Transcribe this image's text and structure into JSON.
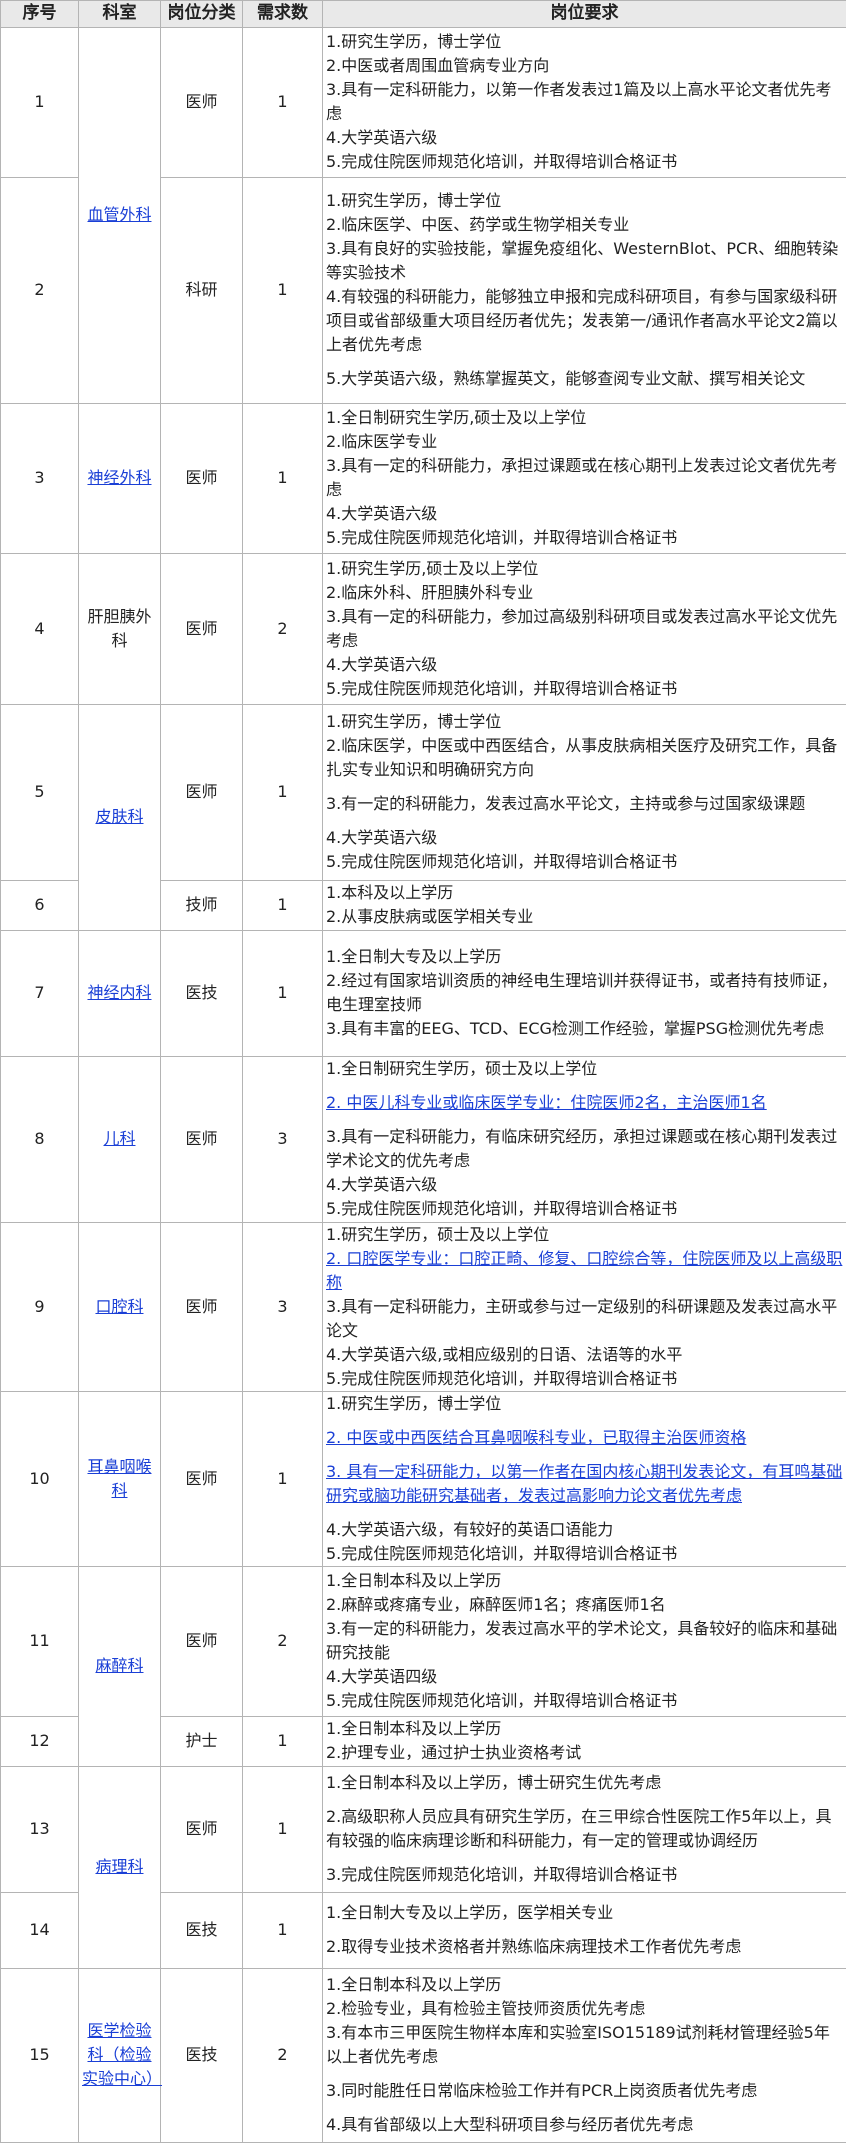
{
  "headers": [
    "序号",
    "科室",
    "岗位分类",
    "需求数",
    "岗位要求"
  ],
  "rows": [
    {
      "no": "1",
      "dept": "血管外科",
      "cat": "医师",
      "num": "1",
      "req": [
        {
          "t": "1.研究生学历，博士学位"
        },
        {
          "t": "2.中医或者周围血管病专业方向"
        },
        {
          "t": "3.具有一定科研能力，以第一作者发表过1篇及以上高水平论文者优先考虑"
        },
        {
          "t": "4.大学英语六级"
        },
        {
          "t": "5.完成住院医师规范化培训，并取得培训合格证书"
        }
      ]
    },
    {
      "no": "2",
      "cat": "科研",
      "num": "1",
      "req": [
        {
          "t": "1.研究生学历，博士学位"
        },
        {
          "t": "2.临床医学、中医、药学或生物学相关专业"
        },
        {
          "t": "3.具有良好的实验技能，掌握免疫组化、WesternBlot、PCR、细胞转染等实验技术"
        },
        {
          "t": "4.有较强的科研能力，能够独立申报和完成科研项目，有参与国家级科研项目或省部级重大项目经历者优先；发表第一/通讯作者高水平论文2篇以上者优先考虑"
        },
        {
          "t": "5.大学英语六级，熟练掌握英文，能够查阅专业文献、撰写相关论文"
        }
      ]
    },
    {
      "no": "3",
      "dept": "神经外科",
      "cat": "医师",
      "num": "1",
      "req": [
        {
          "t": "1.全日制研究生学历,硕士及以上学位"
        },
        {
          "t": "2.临床医学专业"
        },
        {
          "t": "3.具有一定的科研能力，承担过课题或在核心期刊上发表过论文者优先考虑"
        },
        {
          "t": "4.大学英语六级"
        },
        {
          "t": "5.完成住院医师规范化培训，并取得培训合格证书"
        }
      ]
    },
    {
      "no": "4",
      "dept": "肝胆胰外科",
      "cat": "医师",
      "num": "2",
      "req": [
        {
          "t": "1.研究生学历,硕士及以上学位"
        },
        {
          "t": "2.临床外科、肝胆胰外科专业"
        },
        {
          "t": "3.具有一定的科研能力，参加过高级别科研项目或发表过高水平论文优先考虑"
        },
        {
          "t": "4.大学英语六级"
        },
        {
          "t": "5.完成住院医师规范化培训，并取得培训合格证书"
        }
      ]
    },
    {
      "no": "5",
      "dept": "皮肤科",
      "cat": "医师",
      "num": "1",
      "req": [
        {
          "t": "1.研究生学历，博士学位"
        },
        {
          "t": "2.临床医学，中医或中西医结合，从事皮肤病相关医疗及研究工作，具备扎实专业知识和明确研究方向"
        },
        {
          "t": "3.有一定的科研能力，发表过高水平论文，主持或参与过国家级课题"
        },
        {
          "t": "4.大学英语六级"
        },
        {
          "t": "5.完成住院医师规范化培训，并取得培训合格证书"
        }
      ]
    },
    {
      "no": "6",
      "cat": "技师",
      "num": "1",
      "req": [
        {
          "t": "1.本科及以上学历"
        },
        {
          "t": "2.从事皮肤病或医学相关专业"
        }
      ]
    },
    {
      "no": "7",
      "dept": "神经内科",
      "cat": "医技",
      "num": "1",
      "req": [
        {
          "t": "1.全日制大专及以上学历"
        },
        {
          "t": "2.经过有国家培训资质的神经电生理培训并获得证书，或者持有技师证，电生理室技师"
        },
        {
          "t": "3.具有丰富的EEG、TCD、ECG检测工作经验，掌握PSG检测优先考虑"
        }
      ]
    },
    {
      "no": "8",
      "dept": "儿科",
      "cat": "医师",
      "num": "3",
      "req": [
        {
          "t": "1.全日制研究生学历，硕士及以上学位"
        },
        {
          "t": "2. 中医儿科专业或临床医学专业：住院医师2名，主治医师1名",
          "link": true
        },
        {
          "t": "3.具有一定科研能力，有临床研究经历，承担过课题或在核心期刊发表过学术论文的优先考虑"
        },
        {
          "t": "4.大学英语六级"
        },
        {
          "t": "5.完成住院医师规范化培训，并取得培训合格证书"
        }
      ]
    },
    {
      "no": "9",
      "dept": "口腔科",
      "cat": "医师",
      "num": "3",
      "req": [
        {
          "t": "1.研究生学历，硕士及以上学位"
        },
        {
          "t": "2. 口腔医学专业：口腔正畸、修复、口腔综合等，住院医师及以上高级职称",
          "link": true
        },
        {
          "t": "3.具有一定科研能力，主研或参与过一定级别的科研课题及发表过高水平论文"
        },
        {
          "t": "4.大学英语六级,或相应级别的日语、法语等的水平"
        },
        {
          "t": "5.完成住院医师规范化培训，并取得培训合格证书"
        }
      ]
    },
    {
      "no": "10",
      "dept": "耳鼻咽喉科",
      "cat": "医师",
      "num": "1",
      "req": [
        {
          "t": "1.研究生学历，博士学位"
        },
        {
          "t": "2. 中医或中西医结合耳鼻咽喉科专业，已取得主治医师资格",
          "link": true
        },
        {
          "t": "3. 具有一定科研能力，以第一作者在国内核心期刊发表论文，有耳鸣基础研究或脑功能研究基础者，发表过高影响力论文者优先考虑",
          "link": true
        },
        {
          "t": "4.大学英语六级，有较好的英语口语能力"
        },
        {
          "t": "5.完成住院医师规范化培训，并取得培训合格证书"
        }
      ]
    },
    {
      "no": "11",
      "dept": "麻醉科",
      "cat": "医师",
      "num": "2",
      "req": [
        {
          "t": "1.全日制本科及以上学历"
        },
        {
          "t": "2.麻醉或疼痛专业，麻醉医师1名；疼痛医师1名"
        },
        {
          "t": "3.有一定的科研能力，发表过高水平的学术论文，具备较好的临床和基础研究技能"
        },
        {
          "t": "4.大学英语四级"
        },
        {
          "t": "5.完成住院医师规范化培训，并取得培训合格证书"
        }
      ]
    },
    {
      "no": "12",
      "cat": "护士",
      "num": "1",
      "req": [
        {
          "t": "1.全日制本科及以上学历"
        },
        {
          "t": "2.护理专业，通过护士执业资格考试"
        }
      ]
    },
    {
      "no": "13",
      "dept": "病理科",
      "cat": "医师",
      "num": "1",
      "req": [
        {
          "t": "1.全日制本科及以上学历，博士研究生优先考虑"
        },
        {
          "t": "2.高级职称人员应具有研究生学历，在三甲综合性医院工作5年以上，具有较强的临床病理诊断和科研能力，有一定的管理或协调经历"
        },
        {
          "t": "3.完成住院医师规范化培训，并取得培训合格证书"
        }
      ]
    },
    {
      "no": "14",
      "cat": "医技",
      "num": "1",
      "req": [
        {
          "t": "1.全日制大专及以上学历，医学相关专业"
        },
        {
          "t": "2.取得专业技术资格者并熟练临床病理技术工作者优先考虑"
        }
      ]
    },
    {
      "no": "15",
      "dept": "医学检验科（检验实验中心）",
      "cat": "医技",
      "num": "2",
      "req": [
        {
          "t": "1.全日制本科及以上学历"
        },
        {
          "t": "2.检验专业，具有检验主管技师资质优先考虑"
        },
        {
          "t": "3.有本市三甲医院生物样本库和实验室ISO15189试剂耗材管理经验5年以上者优先考虑"
        },
        {
          "t": "3.同时能胜任日常临床检验工作并有PCR上岗资质者优先考虑"
        },
        {
          "t": "4.具有省部级以上大型科研项目参与经历者优先考虑"
        }
      ]
    }
  ]
}
